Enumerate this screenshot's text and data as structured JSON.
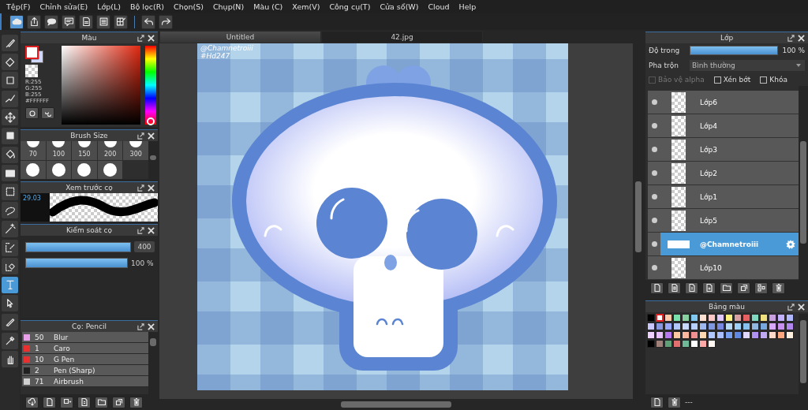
{
  "menu": [
    "Tệp(F)",
    "Chỉnh sửa(E)",
    "Lớp(L)",
    "Bộ lọc(R)",
    "Chọn(S)",
    "Chụp(N)",
    "Màu (C)",
    "Xem(V)",
    "Công cụ(T)",
    "Cửa sổ(W)",
    "Cloud",
    "Help"
  ],
  "toolbar": [
    {
      "kind": "cloud",
      "selected": true
    },
    {
      "kind": "share",
      "selected": false
    },
    {
      "kind": "speech",
      "selected": false
    },
    {
      "kind": "comment",
      "selected": false
    },
    {
      "kind": "document",
      "selected": false
    },
    {
      "kind": "list",
      "selected": false
    },
    {
      "kind": "gridedit",
      "selected": false
    },
    {
      "kind": "undo",
      "selected": false
    },
    {
      "kind": "redo",
      "selected": false
    }
  ],
  "tools": [
    {
      "kind": "brush",
      "selected": false
    },
    {
      "kind": "eraser",
      "selected": false
    },
    {
      "kind": "square",
      "selected": false
    },
    {
      "kind": "polyline",
      "selected": false
    },
    {
      "kind": "move",
      "selected": false
    },
    {
      "kind": "fillrect",
      "selected": false
    },
    {
      "kind": "bucket",
      "selected": false
    },
    {
      "kind": "gradient",
      "selected": false
    },
    {
      "kind": "selectrect",
      "selected": false
    },
    {
      "kind": "lasso",
      "selected": false
    },
    {
      "kind": "wand",
      "selected": false
    },
    {
      "kind": "selectpen",
      "selected": false
    },
    {
      "kind": "selecteraser",
      "selected": false
    },
    {
      "kind": "text",
      "selected": true
    },
    {
      "kind": "pointer",
      "selected": false
    },
    {
      "kind": "knife",
      "selected": false
    },
    {
      "kind": "eyedropper",
      "selected": false
    },
    {
      "kind": "hand",
      "selected": false
    }
  ],
  "color_panel": {
    "title": "Màu",
    "hue": {
      "level": 0
    },
    "r": "R:255",
    "g": "G:255",
    "b": "B:255",
    "hex": "#FFFFFF"
  },
  "brush_size": {
    "title": "Brush Size",
    "sizes": [
      "70",
      "100",
      "150",
      "200",
      "300"
    ]
  },
  "brush_preview": {
    "title": "Xem trước cọ",
    "size": "29.03"
  },
  "brush_control": {
    "title": "Kiểm soát cọ",
    "sliders": [
      {
        "level": 1,
        "value": "400"
      },
      {
        "level": 1,
        "value": "100 %"
      }
    ]
  },
  "brush_list": {
    "title": "Cọ: Pencil",
    "items": [
      {
        "number": "50",
        "name": "Blur",
        "color": "#e8a0e8"
      },
      {
        "number": "1",
        "name": "Caro",
        "color": "#e83030"
      },
      {
        "number": "10",
        "name": "G Pen",
        "color": "#e83030"
      },
      {
        "number": "2",
        "name": "Pen (Sharp)",
        "color": "#202020"
      },
      {
        "number": "71",
        "name": "Airbrush",
        "color": "#d0d0d0"
      }
    ]
  },
  "tabs": [
    {
      "label": "Untitled",
      "selected": true
    },
    {
      "label": "42.jpg",
      "selected": false
    }
  ],
  "canvas_text": [
    "@Chamnetroiii",
    "#Hd247"
  ],
  "layers_panel": {
    "title": "Lớp",
    "opacity_label": "Độ trong",
    "opacity": {
      "level": 1
    },
    "opacity_value": "100 %",
    "blend_label": "Pha trộn",
    "blend_value": "Bình thường",
    "checkboxes": [
      {
        "label": "Bảo vệ alpha",
        "checked": false,
        "disabled": true
      },
      {
        "label": "Xén bớt",
        "checked": false,
        "disabled": false
      },
      {
        "label": "Khóa",
        "checked": false,
        "disabled": false
      }
    ],
    "layers": [
      {
        "name": "Lớp6",
        "visible": true,
        "selected": false
      },
      {
        "name": "Lớp4",
        "visible": true,
        "selected": false
      },
      {
        "name": "Lớp3",
        "visible": true,
        "selected": false
      },
      {
        "name": "Lớp2",
        "visible": true,
        "selected": false
      },
      {
        "name": "Lớp1",
        "visible": true,
        "selected": false
      },
      {
        "name": "Lớp5",
        "visible": true,
        "selected": false
      },
      {
        "name": "@Chamnetroiii",
        "visible": true,
        "selected": true
      },
      {
        "name": "Lớp10",
        "visible": true,
        "selected": false
      }
    ]
  },
  "palette": {
    "title": "Bảng màu",
    "footer": "---",
    "swatches": [
      {
        "color": "#000000",
        "selected": false
      },
      {
        "color": "#ffffff",
        "selected": true
      },
      {
        "color": "#ffc8a8",
        "selected": false
      },
      {
        "color": "#78e0a8",
        "selected": false
      },
      {
        "color": "#88d0a0",
        "selected": false
      },
      {
        "color": "#80c8f0",
        "selected": false
      },
      {
        "color": "#ffe0d0",
        "selected": false
      },
      {
        "color": "#ffc8c8",
        "selected": false
      },
      {
        "color": "#e0c8ff",
        "selected": false
      },
      {
        "color": "#fff080",
        "selected": false
      },
      {
        "color": "#d8a0a0",
        "selected": false
      },
      {
        "color": "#e86060",
        "selected": false
      },
      {
        "color": "#80d8c0",
        "selected": false
      },
      {
        "color": "#f0e080",
        "selected": false
      },
      {
        "color": "#c8a0e0",
        "selected": false
      },
      {
        "color": "#c0b0ff",
        "selected": false
      },
      {
        "color": "#b0b8ff",
        "selected": false
      },
      {
        "color": "#c8c8ff",
        "selected": false
      },
      {
        "color": "#8898e0",
        "selected": false
      },
      {
        "color": "#98a8ff",
        "selected": false
      },
      {
        "color": "#b0c8ff",
        "selected": false
      },
      {
        "color": "#c8d8ff",
        "selected": false
      },
      {
        "color": "#b8d0ff",
        "selected": false
      },
      {
        "color": "#a0b8f0",
        "selected": false
      },
      {
        "color": "#8098e0",
        "selected": false
      },
      {
        "color": "#7888e0",
        "selected": false
      },
      {
        "color": "#b8d8f8",
        "selected": false
      },
      {
        "color": "#a0d0f8",
        "selected": false
      },
      {
        "color": "#88c0f0",
        "selected": false
      },
      {
        "color": "#90b8e0",
        "selected": false
      },
      {
        "color": "#78a8e0",
        "selected": false
      },
      {
        "color": "#d8a8ff",
        "selected": false
      },
      {
        "color": "#c890f0",
        "selected": false
      },
      {
        "color": "#b088f0",
        "selected": false
      },
      {
        "color": "#f0d0ff",
        "selected": false
      },
      {
        "color": "#e8c0ff",
        "selected": false
      },
      {
        "color": "#b878f0",
        "selected": false
      },
      {
        "color": "#ffc8a0",
        "selected": false
      },
      {
        "color": "#ffb8a0",
        "selected": false
      },
      {
        "color": "#f09090",
        "selected": false
      },
      {
        "color": "#ffd8b0",
        "selected": false
      },
      {
        "color": "#b0c8fe",
        "selected": false
      },
      {
        "color": "#a8c0ff",
        "selected": false
      },
      {
        "color": "#78a0f0",
        "selected": false
      },
      {
        "color": "#6088e0",
        "selected": false
      },
      {
        "color": "#e0d8ff",
        "selected": false
      },
      {
        "color": "#b090f0",
        "selected": false
      },
      {
        "color": "#c0a8f0",
        "selected": false
      },
      {
        "color": "#ffd8c8",
        "selected": false
      },
      {
        "color": "#ffa880",
        "selected": false
      },
      {
        "color": "#fff0e0",
        "selected": false
      },
      {
        "color": "#000001",
        "selected": false
      },
      {
        "color": "#a08078",
        "selected": false
      },
      {
        "color": "#60a078",
        "selected": false
      },
      {
        "color": "#e07070",
        "selected": false
      },
      {
        "color": "#70b898",
        "selected": false
      },
      {
        "color": "#fefefe",
        "selected": false
      },
      {
        "color": "#ffa8a8",
        "selected": false
      },
      {
        "color": "#fff8f0",
        "selected": false
      }
    ]
  }
}
